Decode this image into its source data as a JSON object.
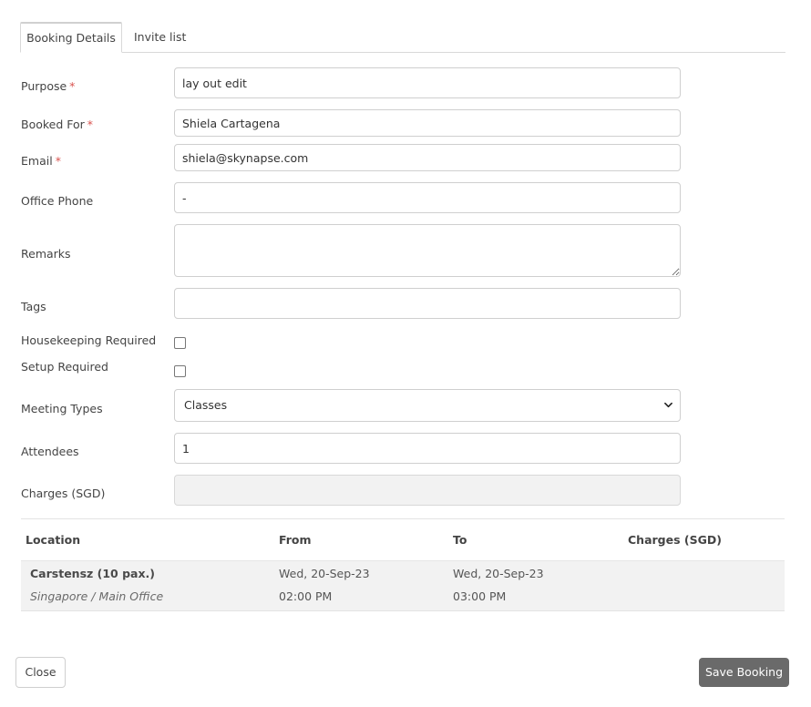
{
  "tabs": [
    {
      "label": "Booking Details"
    },
    {
      "label": "Invite list"
    }
  ],
  "form": {
    "purpose": {
      "label": "Purpose",
      "required": "*",
      "value": "lay out edit"
    },
    "booked_for": {
      "label": "Booked For",
      "required": "*",
      "value": "Shiela Cartagena"
    },
    "email": {
      "label": "Email",
      "required": "*",
      "value": "shiela@skynapse.com"
    },
    "office_phone": {
      "label": "Office Phone",
      "value": "-"
    },
    "remarks": {
      "label": "Remarks",
      "value": ""
    },
    "tags": {
      "label": "Tags",
      "value": ""
    },
    "housekeeping": {
      "label": "Housekeeping Required",
      "checked": false
    },
    "setup": {
      "label": "Setup Required",
      "checked": false
    },
    "meeting_types": {
      "label": "Meeting Types",
      "value": "Classes",
      "icon": "chevron-down-icon"
    },
    "attendees": {
      "label": "Attendees",
      "value": "1"
    },
    "charges": {
      "label": "Charges (SGD)",
      "value": ""
    }
  },
  "table": {
    "headers": [
      "Location",
      "From",
      "To",
      "Charges (SGD)"
    ],
    "rows": [
      {
        "location": "Carstensz (10 pax.)",
        "location_sub": "Singapore / Main Office",
        "from_date": "Wed, 20-Sep-23",
        "from_time": "02:00 PM",
        "to_date": "Wed, 20-Sep-23",
        "to_time": "03:00 PM",
        "charges": ""
      }
    ]
  },
  "buttons": {
    "close": "Close",
    "save": "Save Booking"
  },
  "colors": {
    "required": "#d9534f",
    "save_button": "#6a6a6a"
  }
}
